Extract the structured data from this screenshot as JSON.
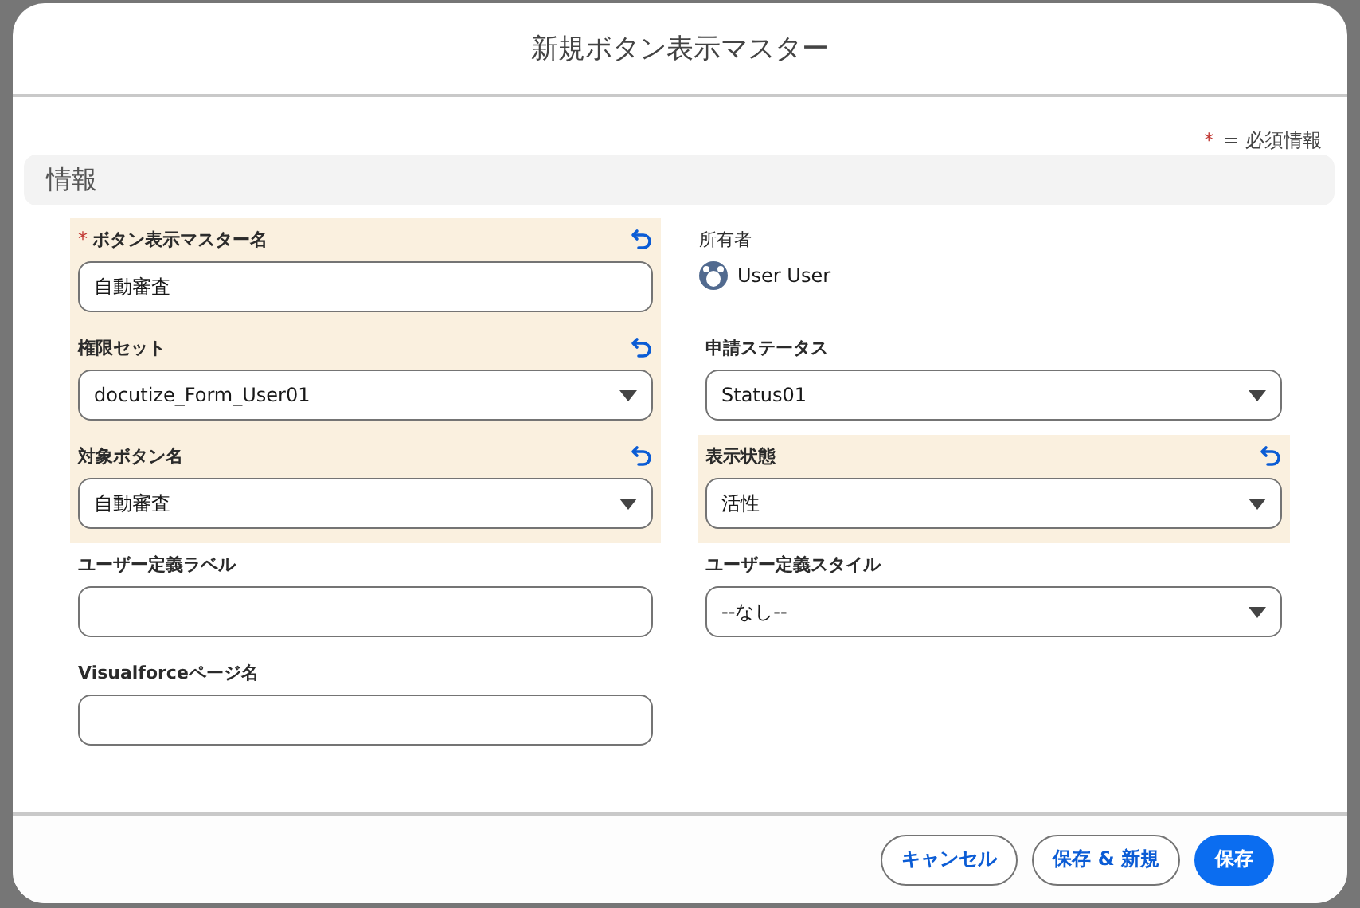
{
  "modal": {
    "title": "新規ボタン表示マスター",
    "required_note": {
      "mark": "*",
      "text": "= 必須情報"
    }
  },
  "section": {
    "title": "情報"
  },
  "fields": [
    {
      "kind": "text",
      "label": "ボタン表示マスター名",
      "required": true,
      "changed": true,
      "value": "自動審査"
    },
    {
      "kind": "owner",
      "label": "所有者",
      "required": false,
      "changed": false,
      "value": "User User"
    },
    {
      "kind": "picklist",
      "label": "権限セット",
      "required": false,
      "changed": true,
      "value": "docutize_Form_User01"
    },
    {
      "kind": "picklist",
      "label": "申請ステータス",
      "required": false,
      "changed": false,
      "value": "Status01"
    },
    {
      "kind": "picklist",
      "label": "対象ボタン名",
      "required": false,
      "changed": true,
      "value": "自動審査"
    },
    {
      "kind": "picklist",
      "label": "表示状態",
      "required": false,
      "changed": true,
      "value": "活性"
    },
    {
      "kind": "text",
      "label": "ユーザー定義ラベル",
      "required": false,
      "changed": false
    },
    {
      "kind": "picklist",
      "label": "ユーザー定義スタイル",
      "required": false,
      "changed": false,
      "value": "--なし--"
    },
    {
      "kind": "text",
      "label": "Visualforceページ名",
      "required": false,
      "changed": false
    }
  ],
  "buttons": [
    {
      "label": "キャンセル",
      "kind": "neutral"
    },
    {
      "label": "保存 & 新規",
      "kind": "neutral"
    },
    {
      "label": "保存",
      "kind": "brand"
    }
  ]
}
